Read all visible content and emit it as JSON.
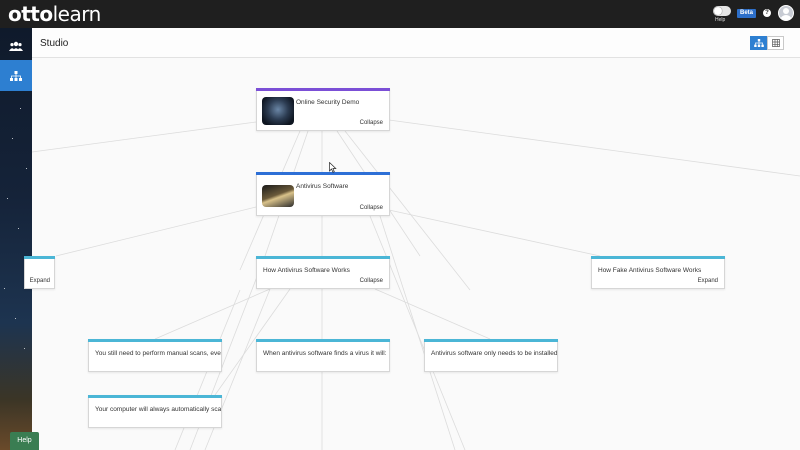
{
  "topbar": {
    "logo_otto": "otto",
    "logo_learn": "learn",
    "help_label": "Help",
    "beta_label": "Beta",
    "question_label": "?",
    "colors": {
      "bar": "#1f1f1f",
      "beta": "#2d6fc9"
    }
  },
  "sidebar": {
    "items": [
      {
        "name": "users",
        "icon": "users-icon"
      },
      {
        "name": "studio",
        "icon": "hierarchy-icon",
        "active": true
      }
    ],
    "help_button": "Help",
    "colors": {
      "active": "#2d7fd1",
      "help": "#3a7d52"
    }
  },
  "header": {
    "title": "Studio",
    "views": [
      {
        "name": "tree-view",
        "icon": "hierarchy-icon",
        "selected": true
      },
      {
        "name": "grid-view",
        "icon": "grid-icon",
        "selected": false
      }
    ]
  },
  "nodes": {
    "root": {
      "title": "Online Security Demo",
      "action": "Collapse",
      "bar_color": "#7b4fd6"
    },
    "antivirus": {
      "title": "Antivirus Software",
      "action": "Collapse",
      "bar_color": "#2d6fd6"
    },
    "left_partial": {
      "title": "",
      "action": "Expand",
      "bar_color": "#4bb6d6"
    },
    "how_works": {
      "title": "How Antivirus Software Works",
      "action": "Collapse",
      "bar_color": "#4bb6d6"
    },
    "fake": {
      "title": "How Fake Antivirus Software Works",
      "action": "Expand",
      "bar_color": "#4bb6d6"
    },
    "q1": {
      "title": "You still need to perform manual scans, even w",
      "bar_color": "#4bb6d6"
    },
    "q2": {
      "title": "When antivirus software finds a virus it will:",
      "bar_color": "#4bb6d6"
    },
    "q3": {
      "title": "Antivirus software only needs to be installed or",
      "bar_color": "#4bb6d6"
    },
    "q4": {
      "title": "Your computer will always automatically scan a",
      "bar_color": "#4bb6d6"
    }
  }
}
